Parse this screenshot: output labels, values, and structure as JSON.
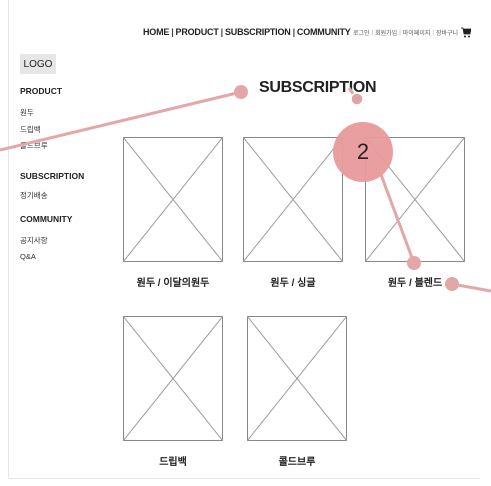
{
  "nav": {
    "items": [
      "HOME",
      "PRODUCT",
      "SUBSCRIPTION",
      "COMMUNITY"
    ]
  },
  "util": {
    "login": "로그인",
    "join": "회원가입",
    "mypage": "마이페이지",
    "cart": "장바구니"
  },
  "logo": "LOGO",
  "sidebar": {
    "product_title": "PRODUCT",
    "product_items": [
      "원두",
      "드립백",
      "콜드브루"
    ],
    "subscription_title": "SUBSCRIPTION",
    "subscription_items": [
      "정기배송"
    ],
    "community_title": "COMMUNITY",
    "community_items": [
      "공지사항",
      "Q&A"
    ]
  },
  "page_title": "SUBSCRIPTION",
  "products": [
    "원두 / 이달의원두",
    "원두 / 싱글",
    "원두 / 블렌드",
    "드립백",
    "콜드브루"
  ],
  "annotation": {
    "badge": "2",
    "color": "#e89a9a"
  }
}
